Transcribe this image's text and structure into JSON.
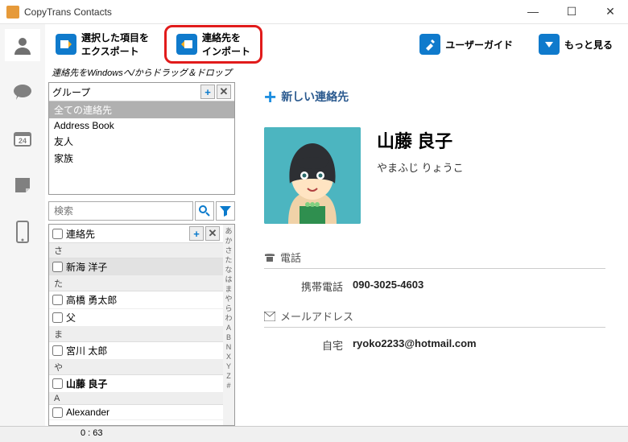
{
  "app_title": "CopyTrans Contacts",
  "toolbar": {
    "export_line1": "選択した項目を",
    "export_line2": "エクスポート",
    "import_line1": "連絡先を",
    "import_line2": "インポート",
    "guide": "ユーザーガイド",
    "more": "もっと見る"
  },
  "drag_hint": "連絡先をWindowsへ/からドラッグ＆ドロップ",
  "groups": {
    "header": "グループ",
    "items": [
      "全ての連絡先",
      "Address Book",
      "友人",
      "家族"
    ],
    "selected_index": 0
  },
  "search_placeholder": "検索",
  "contacts_header": "連絡先",
  "alpha_index": [
    "あ",
    "か",
    "さ",
    "た",
    "な",
    "は",
    "ま",
    "や",
    "ら",
    "わ",
    "A",
    "B",
    "N",
    "X",
    "Y",
    "Z",
    "#"
  ],
  "contacts": [
    {
      "type": "letter",
      "text": "さ"
    },
    {
      "type": "item",
      "name": "新海 洋子",
      "bold": false,
      "sel": true
    },
    {
      "type": "letter",
      "text": "た"
    },
    {
      "type": "item",
      "name": "高橋 勇太郎",
      "bold": false
    },
    {
      "type": "item",
      "name": "父",
      "bold": false
    },
    {
      "type": "letter",
      "text": "ま"
    },
    {
      "type": "item",
      "name": "宮川 太郎",
      "bold": false
    },
    {
      "type": "letter",
      "text": "や"
    },
    {
      "type": "item",
      "name": "山藤 良子",
      "bold": true
    },
    {
      "type": "letter",
      "text": "A"
    },
    {
      "type": "item",
      "name": "Alexander",
      "bold": false
    }
  ],
  "new_contact_label": "新しい連絡先",
  "detail": {
    "fullname": "山藤 良子",
    "reading": "やまふじ りょうこ",
    "phone_section": "電話",
    "phone_label": "携帯電話",
    "phone_value": "090-3025-4603",
    "email_section": "メールアドレス",
    "email_label": "自宅",
    "email_value": "ryoko2233@hotmail.com"
  },
  "status": "0 : 63"
}
